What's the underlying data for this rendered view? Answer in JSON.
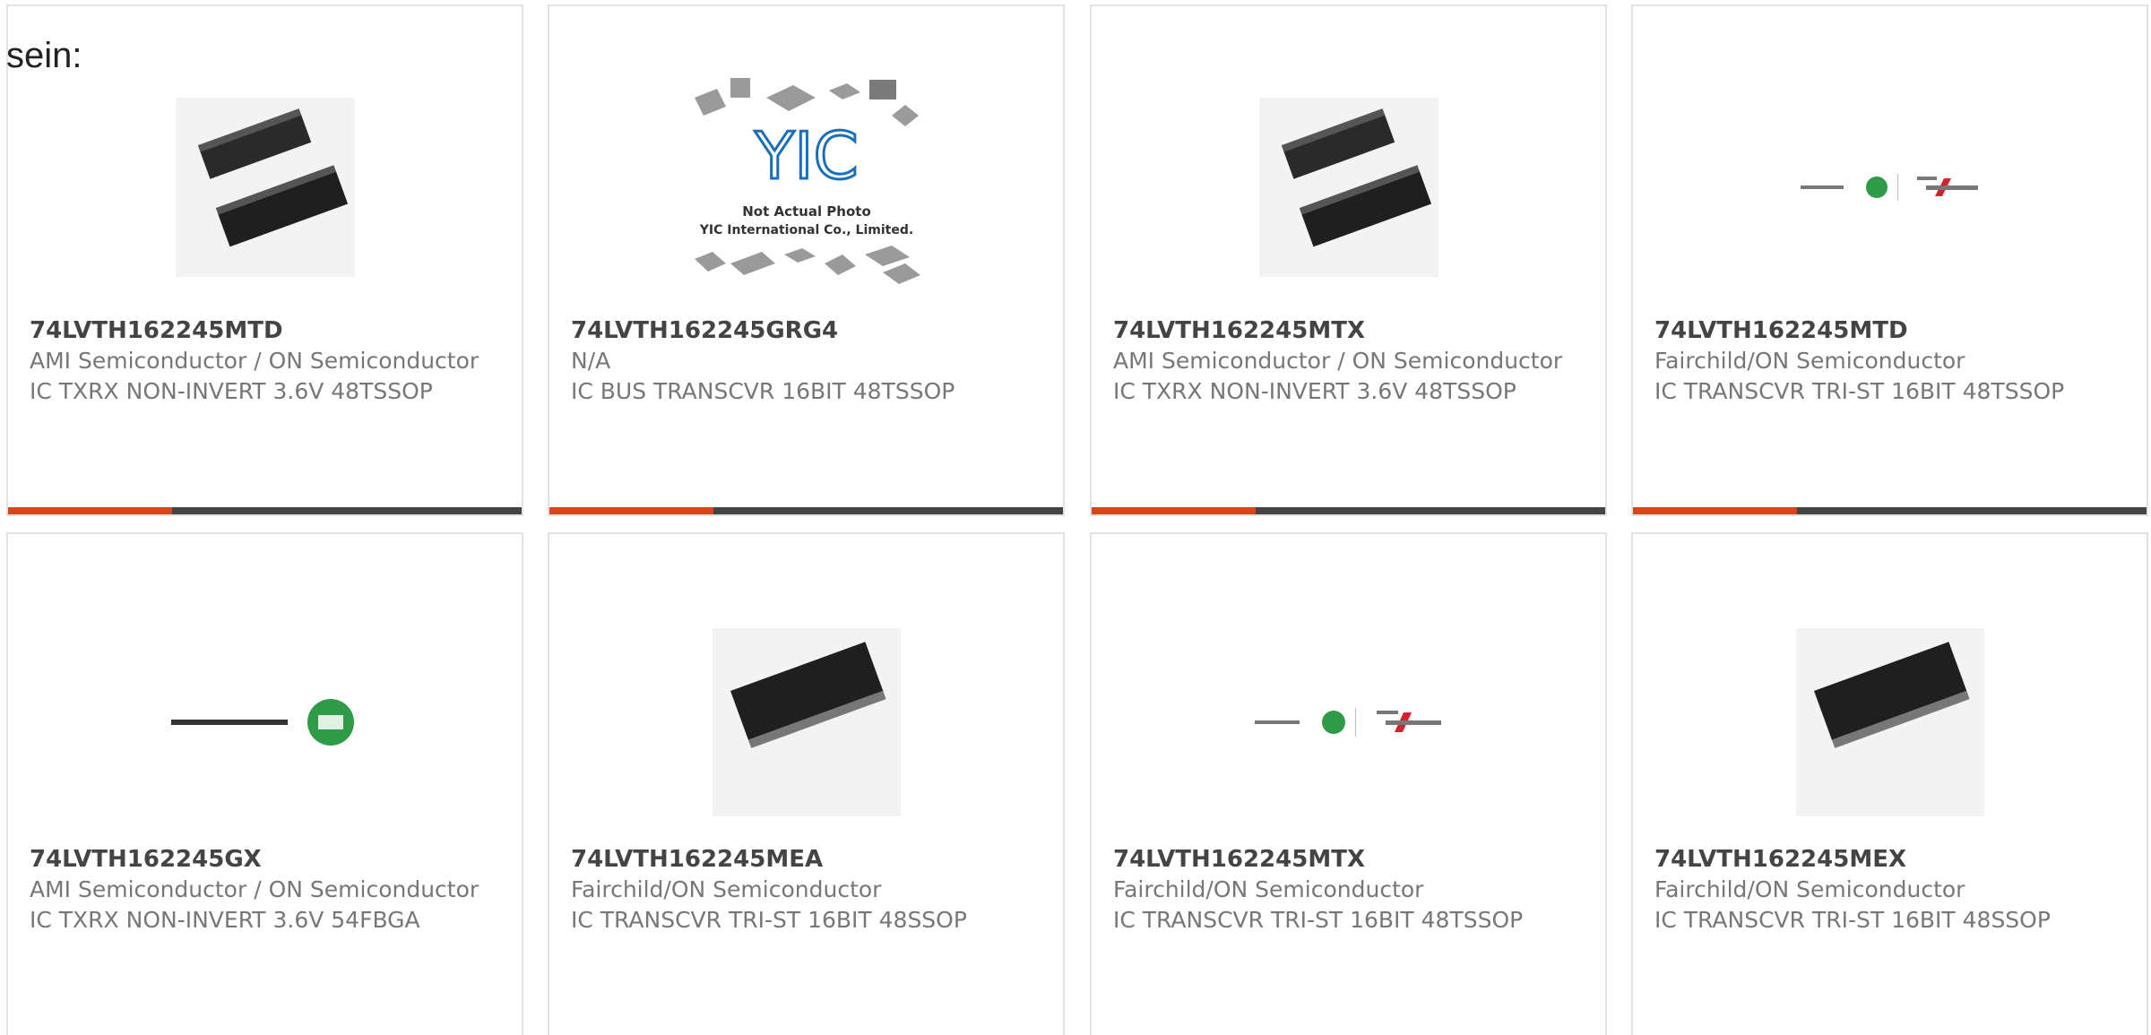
{
  "intro_text": "sein:",
  "colors": {
    "accent": "#e0421c",
    "bar": "#444444",
    "border": "#e2e2e2",
    "text": "#777777",
    "title": "#444444"
  },
  "products": [
    {
      "part_number": "74LVTH162245MTD",
      "manufacturer": "AMI Semiconductor / ON Semiconductor",
      "description": "IC TXRX NON-INVERT 3.6V 48TSSOP",
      "image": "two-tssop-chips-image"
    },
    {
      "part_number": "74LVTH162245GRG4",
      "manufacturer": "N/A",
      "description": "IC BUS TRANSCVR 16BIT 48TSSOP",
      "image": "yic-placeholder-image",
      "image_text": {
        "logo": "YIC",
        "line1": "Not Actual Photo",
        "line2": "YIC International Co., Limited."
      }
    },
    {
      "part_number": "74LVTH162245MTX",
      "manufacturer": "AMI Semiconductor / ON Semiconductor",
      "description": "IC TXRX NON-INVERT 3.6V 48TSSOP",
      "image": "two-tssop-chips-image"
    },
    {
      "part_number": "74LVTH162245MTD",
      "manufacturer": "Fairchild/ON Semiconductor",
      "description": "IC TRANSCVR TRI-ST 16BIT 48TSSOP",
      "image": "on-fairchild-logo-image"
    },
    {
      "part_number": "74LVTH162245GX",
      "manufacturer": "AMI Semiconductor / ON Semiconductor",
      "description": "IC TXRX NON-INVERT 3.6V 54FBGA",
      "image": "on-semiconductor-logo-image"
    },
    {
      "part_number": "74LVTH162245MEA",
      "manufacturer": "Fairchild/ON Semiconductor",
      "description": "IC TRANSCVR TRI-ST 16BIT 48SSOP",
      "image": "ssop-chip-image"
    },
    {
      "part_number": "74LVTH162245MTX",
      "manufacturer": "Fairchild/ON Semiconductor",
      "description": "IC TRANSCVR TRI-ST 16BIT 48TSSOP",
      "image": "on-fairchild-logo-image"
    },
    {
      "part_number": "74LVTH162245MEX",
      "manufacturer": "Fairchild/ON Semiconductor",
      "description": "IC TRANSCVR TRI-ST 16BIT 48SSOP",
      "image": "ssop-chip-image"
    }
  ]
}
